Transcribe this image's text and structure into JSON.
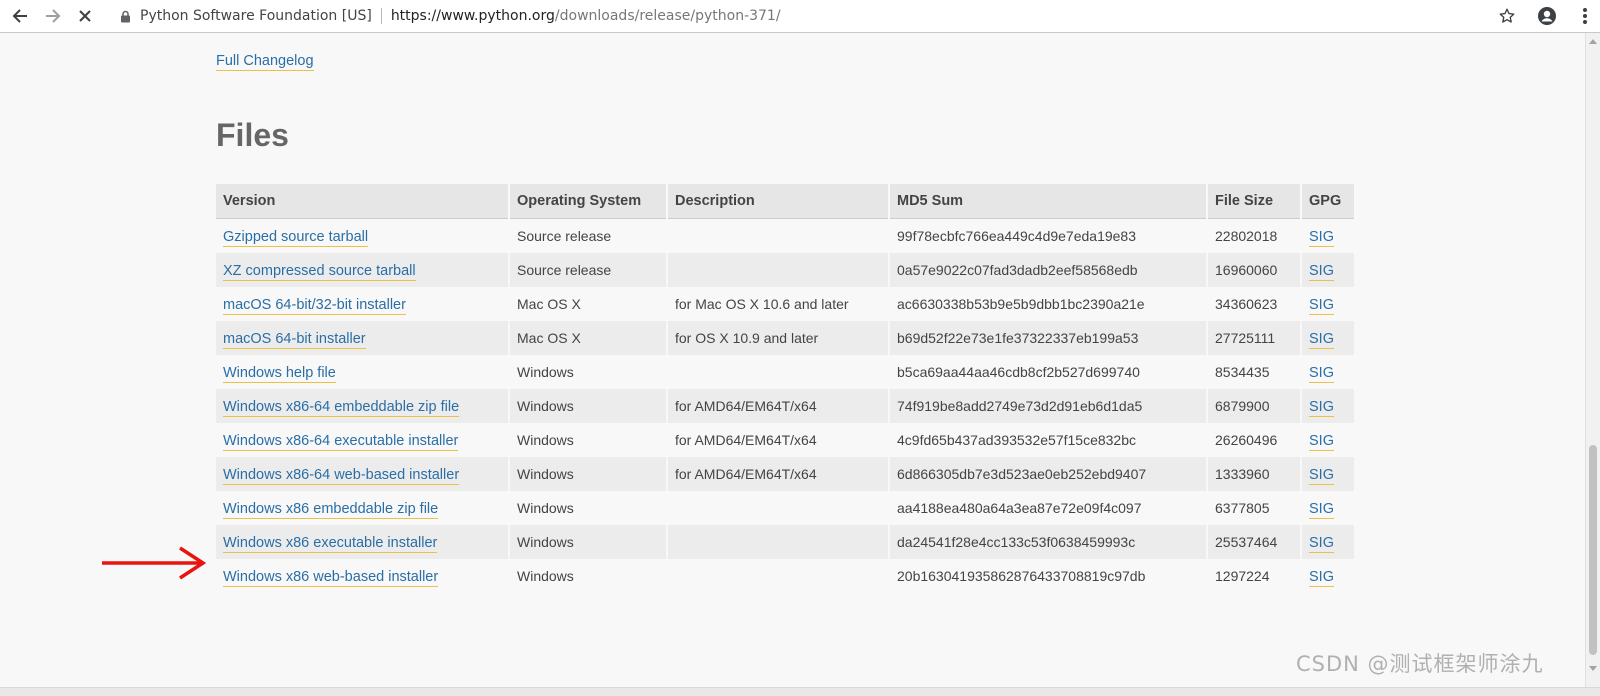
{
  "browser": {
    "site_name": "Python Software Foundation [US]",
    "url_host": "https://www.python.org",
    "url_path": "/downloads/release/python-371/"
  },
  "page": {
    "changelog_link": "Full Changelog",
    "files_heading": "Files",
    "columns": [
      "Version",
      "Operating System",
      "Description",
      "MD5 Sum",
      "File Size",
      "GPG"
    ],
    "rows": [
      {
        "version": "Gzipped source tarball",
        "os": "Source release",
        "description": "",
        "md5": "99f78ecbfc766ea449c4d9e7eda19e83",
        "size": "22802018",
        "gpg": "SIG"
      },
      {
        "version": "XZ compressed source tarball",
        "os": "Source release",
        "description": "",
        "md5": "0a57e9022c07fad3dadb2eef58568edb",
        "size": "16960060",
        "gpg": "SIG"
      },
      {
        "version": "macOS 64-bit/32-bit installer",
        "os": "Mac OS X",
        "description": "for Mac OS X 10.6 and later",
        "md5": "ac6630338b53b9e5b9dbb1bc2390a21e",
        "size": "34360623",
        "gpg": "SIG"
      },
      {
        "version": "macOS 64-bit installer",
        "os": "Mac OS X",
        "description": "for OS X 10.9 and later",
        "md5": "b69d52f22e73e1fe37322337eb199a53",
        "size": "27725111",
        "gpg": "SIG"
      },
      {
        "version": "Windows help file",
        "os": "Windows",
        "description": "",
        "md5": "b5ca69aa44aa46cdb8cf2b527d699740",
        "size": "8534435",
        "gpg": "SIG"
      },
      {
        "version": "Windows x86-64 embeddable zip file",
        "os": "Windows",
        "description": "for AMD64/EM64T/x64",
        "md5": "74f919be8add2749e73d2d91eb6d1da5",
        "size": "6879900",
        "gpg": "SIG"
      },
      {
        "version": "Windows x86-64 executable installer",
        "os": "Windows",
        "description": "for AMD64/EM64T/x64",
        "md5": "4c9fd65b437ad393532e57f15ce832bc",
        "size": "26260496",
        "gpg": "SIG"
      },
      {
        "version": "Windows x86-64 web-based installer",
        "os": "Windows",
        "description": "for AMD64/EM64T/x64",
        "md5": "6d866305db7e3d523ae0eb252ebd9407",
        "size": "1333960",
        "gpg": "SIG"
      },
      {
        "version": "Windows x86 embeddable zip file",
        "os": "Windows",
        "description": "",
        "md5": "aa4188ea480a64a3ea87e72e09f4c097",
        "size": "6377805",
        "gpg": "SIG"
      },
      {
        "version": "Windows x86 executable installer",
        "os": "Windows",
        "description": "",
        "md5": "da24541f28e4cc133c53f0638459993c",
        "size": "25537464",
        "gpg": "SIG"
      },
      {
        "version": "Windows x86 web-based installer",
        "os": "Windows",
        "description": "",
        "md5": "20b163041935862876433708819c97db",
        "size": "1297224",
        "gpg": "SIG"
      }
    ]
  },
  "annotation": {
    "arrow_color": "#e8140e",
    "highlighted_row": "Windows x86 executable installer"
  },
  "watermark": "CSDN @测试框架师涂九",
  "colors": {
    "link": "#2a6ea6",
    "link_underline": "#e8c14c",
    "header_bg": "#e6e6e6"
  }
}
